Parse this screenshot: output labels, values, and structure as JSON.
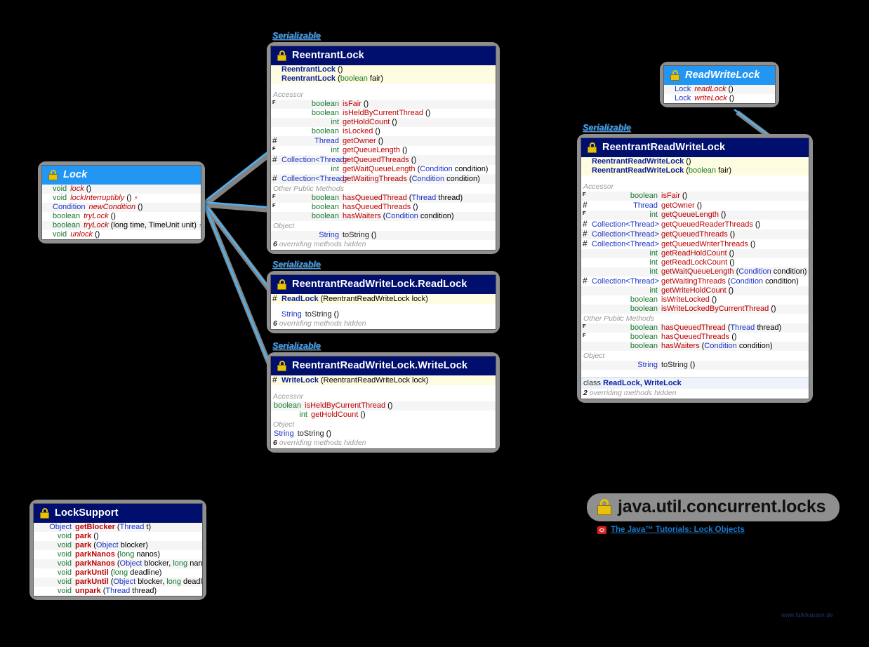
{
  "package": {
    "title": "java.util.concurrent.locks",
    "lock_icon": "lock-icon",
    "tutorial_link": "The Java™ Tutorials: Lock Objects",
    "watermark": "www.falkhausen.de"
  },
  "labels": {
    "serializable": "Serializable"
  },
  "colors": {
    "class_header": "#000e6e",
    "interface_header": "#2196f3",
    "constructor_band": "#fdfbe0",
    "connector": "#4db2f0",
    "box_frame": "#8f8f8f",
    "method_name": "#c00000",
    "ref_type": "#1a33c8",
    "primitive_type": "#157a2e"
  },
  "boxes": {
    "lock": {
      "name": "Lock",
      "kind": "interface",
      "methods": [
        {
          "mod": "",
          "ret": "void",
          "ret_kind": "void",
          "name": "lock",
          "args": "()",
          "italic": true,
          "throws": false
        },
        {
          "mod": "",
          "ret": "void",
          "ret_kind": "void",
          "name": "lockInterruptibly",
          "args": "()",
          "italic": true,
          "throws": true
        },
        {
          "mod": "",
          "ret": "Condition",
          "ret_kind": "ref",
          "name": "newCondition",
          "args": "()",
          "italic": true,
          "throws": false
        },
        {
          "mod": "",
          "ret": "boolean",
          "ret_kind": "prim",
          "name": "tryLock",
          "args": "()",
          "italic": true,
          "throws": false
        },
        {
          "mod": "",
          "ret": "boolean",
          "ret_kind": "prim",
          "name": "tryLock",
          "args": "(long time, TimeUnit unit)",
          "italic": true,
          "throws": true
        },
        {
          "mod": "",
          "ret": "void",
          "ret_kind": "void",
          "name": "unlock",
          "args": "()",
          "italic": true,
          "throws": false
        }
      ]
    },
    "read_write_lock": {
      "name": "ReadWriteLock",
      "kind": "interface",
      "methods": [
        {
          "mod": "",
          "ret": "Lock",
          "ret_kind": "ref",
          "name": "readLock",
          "args": "()",
          "italic": true,
          "throws": false
        },
        {
          "mod": "",
          "ret": "Lock",
          "ret_kind": "ref",
          "name": "writeLock",
          "args": "()",
          "italic": true,
          "throws": false
        }
      ]
    },
    "reentrant_lock": {
      "name": "ReentrantLock",
      "kind": "class",
      "serializable": true,
      "constructors": [
        {
          "name": "ReentrantLock",
          "args": "()"
        },
        {
          "name": "ReentrantLock",
          "args": "(boolean fair)",
          "arg_type": "boolean",
          "arg_name": "fair"
        }
      ],
      "groups": [
        {
          "title": "Accessor",
          "methods": [
            {
              "mod": "F",
              "ret": "boolean",
              "ret_kind": "prim",
              "name": "isFair",
              "args": "()"
            },
            {
              "mod": "",
              "ret": "boolean",
              "ret_kind": "prim",
              "name": "isHeldByCurrentThread",
              "args": "()"
            },
            {
              "mod": "",
              "ret": "int",
              "ret_kind": "prim",
              "name": "getHoldCount",
              "args": "()"
            },
            {
              "mod": "",
              "ret": "boolean",
              "ret_kind": "prim",
              "name": "isLocked",
              "args": "()"
            },
            {
              "mod": "#",
              "ret": "Thread",
              "ret_kind": "ref",
              "name": "getOwner",
              "args": "()"
            },
            {
              "mod": "F",
              "ret": "int",
              "ret_kind": "prim",
              "name": "getQueueLength",
              "args": "()"
            },
            {
              "mod": "#",
              "ret": "Collection<Thread>",
              "ret_kind": "ref",
              "name": "getQueuedThreads",
              "args": "()"
            },
            {
              "mod": "",
              "ret": "int",
              "ret_kind": "prim",
              "name": "getWaitQueueLength",
              "args": "(Condition condition)"
            },
            {
              "mod": "#",
              "ret": "Collection<Thread>",
              "ret_kind": "ref",
              "name": "getWaitingThreads",
              "args": "(Condition condition)"
            }
          ]
        },
        {
          "title": "Other Public Methods",
          "methods": [
            {
              "mod": "F",
              "ret": "boolean",
              "ret_kind": "prim",
              "name": "hasQueuedThread",
              "args": "(Thread thread)"
            },
            {
              "mod": "F",
              "ret": "boolean",
              "ret_kind": "prim",
              "name": "hasQueuedThreads",
              "args": "()"
            },
            {
              "mod": "",
              "ret": "boolean",
              "ret_kind": "prim",
              "name": "hasWaiters",
              "args": "(Condition condition)"
            }
          ]
        },
        {
          "title": "Object",
          "methods": [
            {
              "mod": "",
              "ret": "String",
              "ret_kind": "ref",
              "name": "toString",
              "args": "()",
              "plain": true
            }
          ]
        }
      ],
      "hidden_count": "6",
      "hidden_note": "overriding methods hidden"
    },
    "read_lock": {
      "name": "ReentrantReadWriteLock.ReadLock",
      "kind": "class",
      "serializable": true,
      "constructors": [
        {
          "mod": "#",
          "name": "ReadLock",
          "args": "(ReentrantReadWriteLock lock)"
        }
      ],
      "groups": [
        {
          "title": "",
          "methods": [
            {
              "mod": "",
              "ret": "String",
              "ret_kind": "ref",
              "name": "toString",
              "args": "()",
              "plain": true
            }
          ]
        }
      ],
      "hidden_count": "6",
      "hidden_note": "overriding methods hidden"
    },
    "write_lock": {
      "name": "ReentrantReadWriteLock.WriteLock",
      "kind": "class",
      "serializable": true,
      "constructors": [
        {
          "mod": "#",
          "name": "WriteLock",
          "args": "(ReentrantReadWriteLock lock)"
        }
      ],
      "groups": [
        {
          "title": "Accessor",
          "methods": [
            {
              "mod": "",
              "ret": "boolean",
              "ret_kind": "prim",
              "name": "isHeldByCurrentThread",
              "args": "()"
            },
            {
              "mod": "",
              "ret": "int",
              "ret_kind": "prim",
              "name": "getHoldCount",
              "args": "()"
            }
          ]
        },
        {
          "title": "Object",
          "methods": [
            {
              "mod": "",
              "ret": "String",
              "ret_kind": "ref",
              "name": "toString",
              "args": "()",
              "plain": true
            }
          ]
        }
      ],
      "hidden_count": "6",
      "hidden_note": "overriding methods hidden"
    },
    "reentrant_rw_lock": {
      "name": "ReentrantReadWriteLock",
      "kind": "class",
      "serializable": true,
      "constructors": [
        {
          "name": "ReentrantReadWriteLock",
          "args": "()"
        },
        {
          "name": "ReentrantReadWriteLock",
          "args": "(boolean fair)",
          "arg_type": "boolean",
          "arg_name": "fair"
        }
      ],
      "groups": [
        {
          "title": "Accessor",
          "methods": [
            {
              "mod": "F",
              "ret": "boolean",
              "ret_kind": "prim",
              "name": "isFair",
              "args": "()"
            },
            {
              "mod": "#",
              "ret": "Thread",
              "ret_kind": "ref",
              "name": "getOwner",
              "args": "()"
            },
            {
              "mod": "F",
              "ret": "int",
              "ret_kind": "prim",
              "name": "getQueueLength",
              "args": "()"
            },
            {
              "mod": "#",
              "ret": "Collection<Thread>",
              "ret_kind": "ref",
              "name": "getQueuedReaderThreads",
              "args": "()"
            },
            {
              "mod": "#",
              "ret": "Collection<Thread>",
              "ret_kind": "ref",
              "name": "getQueuedThreads",
              "args": "()"
            },
            {
              "mod": "#",
              "ret": "Collection<Thread>",
              "ret_kind": "ref",
              "name": "getQueuedWriterThreads",
              "args": "()"
            },
            {
              "mod": "",
              "ret": "int",
              "ret_kind": "prim",
              "name": "getReadHoldCount",
              "args": "()"
            },
            {
              "mod": "",
              "ret": "int",
              "ret_kind": "prim",
              "name": "getReadLockCount",
              "args": "()"
            },
            {
              "mod": "",
              "ret": "int",
              "ret_kind": "prim",
              "name": "getWaitQueueLength",
              "args": "(Condition condition)"
            },
            {
              "mod": "#",
              "ret": "Collection<Thread>",
              "ret_kind": "ref",
              "name": "getWaitingThreads",
              "args": "(Condition condition)"
            },
            {
              "mod": "",
              "ret": "int",
              "ret_kind": "prim",
              "name": "getWriteHoldCount",
              "args": "()"
            },
            {
              "mod": "",
              "ret": "boolean",
              "ret_kind": "prim",
              "name": "isWriteLocked",
              "args": "()"
            },
            {
              "mod": "",
              "ret": "boolean",
              "ret_kind": "prim",
              "name": "isWriteLockedByCurrentThread",
              "args": "()"
            }
          ]
        },
        {
          "title": "Other Public Methods",
          "methods": [
            {
              "mod": "F",
              "ret": "boolean",
              "ret_kind": "prim",
              "name": "hasQueuedThread",
              "args": "(Thread thread)"
            },
            {
              "mod": "F",
              "ret": "boolean",
              "ret_kind": "prim",
              "name": "hasQueuedThreads",
              "args": "()"
            },
            {
              "mod": "",
              "ret": "boolean",
              "ret_kind": "prim",
              "name": "hasWaiters",
              "args": "(Condition condition)"
            }
          ]
        },
        {
          "title": "Object",
          "methods": [
            {
              "mod": "",
              "ret": "String",
              "ret_kind": "ref",
              "name": "toString",
              "args": "()",
              "plain": true
            }
          ]
        }
      ],
      "nested_label": "class",
      "nested_classes": "ReadLock, WriteLock",
      "hidden_count": "2",
      "hidden_note": "overriding methods hidden"
    },
    "lock_support": {
      "name": "LockSupport",
      "kind": "class",
      "methods": [
        {
          "ret": "Object",
          "ret_kind": "ref",
          "name": "getBlocker",
          "args": "(Thread t)"
        },
        {
          "ret": "void",
          "ret_kind": "void",
          "name": "park",
          "args": "()"
        },
        {
          "ret": "void",
          "ret_kind": "void",
          "name": "park",
          "args": "(Object blocker)"
        },
        {
          "ret": "void",
          "ret_kind": "void",
          "name": "parkNanos",
          "args": "(long nanos)"
        },
        {
          "ret": "void",
          "ret_kind": "void",
          "name": "parkNanos",
          "args": "(Object blocker, long nanos)"
        },
        {
          "ret": "void",
          "ret_kind": "void",
          "name": "parkUntil",
          "args": "(long deadline)"
        },
        {
          "ret": "void",
          "ret_kind": "void",
          "name": "parkUntil",
          "args": "(Object blocker, long deadline)"
        },
        {
          "ret": "void",
          "ret_kind": "void",
          "name": "unpark",
          "args": "(Thread thread)"
        }
      ]
    }
  }
}
